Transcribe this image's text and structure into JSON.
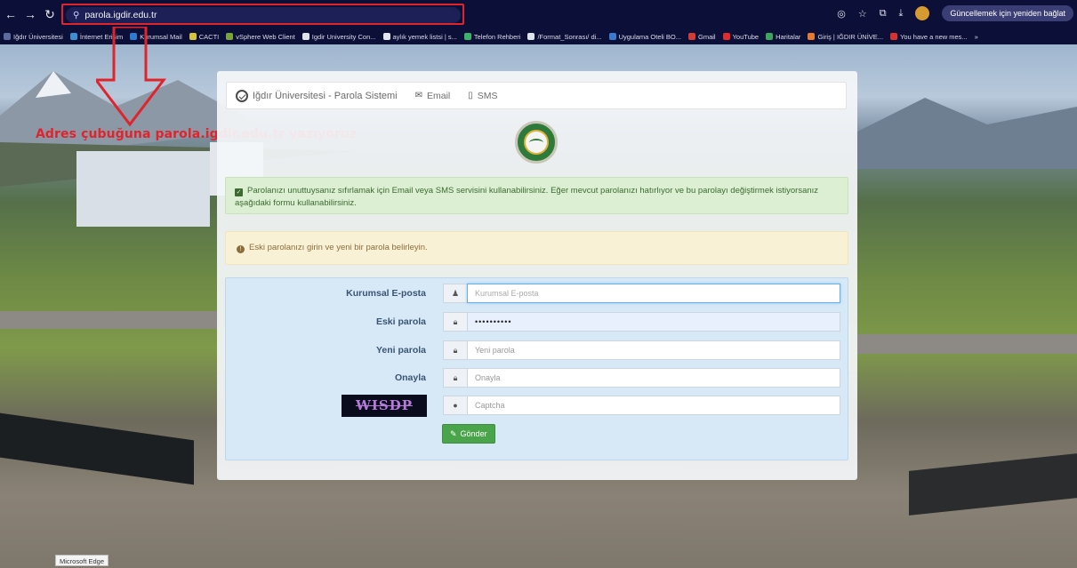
{
  "browser": {
    "url": "parola.igdir.edu.tr",
    "update_label": "Güncellemek için yeniden bağlat",
    "status_text": "Microsoft Edge",
    "bookmarks": [
      "Iğdır Üniversitesi",
      "İnternet Erişim",
      "Kurumsal Mail",
      "CACTI",
      "vSphere Web Client",
      "Igdir University Con...",
      "aylık yemek listsi | s...",
      "Telefon Rehberi",
      "/Format_Sonrası/ di...",
      "Uygulama Oteli BO...",
      "Gmail",
      "YouTube",
      "Haritalar",
      "Giriş | IĞDIR ÜNİVE...",
      "You have a new mes..."
    ]
  },
  "annotation": {
    "text": "Adres çubuğuna parola.igdir.edu.tr yazıyoruz",
    "color": "#e0242c"
  },
  "navbar": {
    "brand": "Iğdır Üniversitesi - Parola Sistemi",
    "email_label": "Email",
    "sms_label": "SMS"
  },
  "alerts": {
    "success": "Parolanızı unuttuysanız sıfırlamak için Email veya SMS servisini kullanabilirsiniz. Eğer mevcut parolanızı hatırlıyor ve bu parolayı değiştirmek istiyorsanız aşağıdaki formu kullanabilirsiniz.",
    "warning": "Eski parolanızı girin ve yeni bir parola belirleyin."
  },
  "form": {
    "email": {
      "label": "Kurumsal E-posta",
      "placeholder": "Kurumsal E-posta"
    },
    "old_password": {
      "label": "Eski parola",
      "value": "••••••••••"
    },
    "new_password": {
      "label": "Yeni parola",
      "placeholder": "Yeni parola"
    },
    "confirm": {
      "label": "Onayla",
      "placeholder": "Onayla"
    },
    "captcha": {
      "image_text": "WISDP",
      "placeholder": "Captcha"
    },
    "submit_label": "Gönder"
  },
  "colors": {
    "success_bg": "#dcefd3",
    "warning_bg": "#f8f1d6",
    "form_bg": "#d7e9f6",
    "submit_bg": "#4aa54a",
    "browser_bg": "#0c0f38"
  },
  "icons": {
    "back": "arrow-left-icon",
    "forward": "arrow-right-icon",
    "reload": "reload-icon",
    "user": "user-icon",
    "lock": "lock-icon",
    "captcha": "captcha-icon",
    "envelope": "envelope-icon",
    "mobile": "mobile-icon"
  }
}
